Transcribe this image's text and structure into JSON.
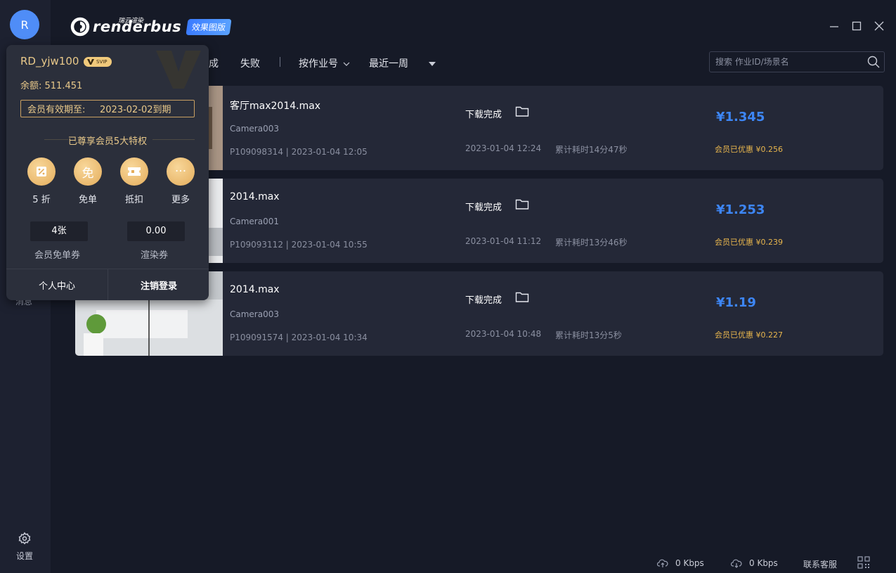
{
  "app": {
    "logo_small": "瑞云渲染",
    "logo_name": "renderbus",
    "logo_badge": "效果图版"
  },
  "rail": {
    "avatar_letter": "R",
    "messages_label": "消息",
    "settings_label": "设置"
  },
  "filter": {
    "tab_done_partial": "成",
    "tab_failed": "失败",
    "sort_by_job": "按作业号",
    "range": "最近一周",
    "search_placeholder": "搜索 作业ID/场景名"
  },
  "jobs": [
    {
      "title": "客厅max2014.max",
      "camera": "Camera003",
      "meta": "P109098314 | 2023-01-04 12:05",
      "status": "下载完成",
      "end_time": "2023-01-04 12:24",
      "duration": "累计耗时14分47秒",
      "price": "¥1.345",
      "discount": "会员已优惠 ¥0.256"
    },
    {
      "title": "2014.max",
      "camera": "Camera001",
      "meta": "P109093112 | 2023-01-04 10:55",
      "status": "下载完成",
      "end_time": "2023-01-04 11:12",
      "duration": "累计耗时13分46秒",
      "price": "¥1.253",
      "discount": "会员已优惠 ¥0.239"
    },
    {
      "title": "2014.max",
      "camera": "Camera003",
      "meta": "P109091574 | 2023-01-04 10:34",
      "status": "下载完成",
      "end_time": "2023-01-04 10:48",
      "duration": "累计耗时13分5秒",
      "price": "¥1.19",
      "discount": "会员已优惠 ¥0.227"
    }
  ],
  "popover": {
    "username": "RD_yjw100",
    "svip": "SVIP",
    "balance": "余额: 511.451",
    "valid_label": "会员有效期至:",
    "valid_value": "2023-02-02到期",
    "privileges_title": "已尊享会员5大特权",
    "perks": [
      {
        "label": "5 折",
        "icon": "percent-icon"
      },
      {
        "label": "免单",
        "icon": "free-icon",
        "glyph": "免"
      },
      {
        "label": "抵扣",
        "icon": "coupon-icon"
      },
      {
        "label": "更多",
        "icon": "more-icon",
        "glyph": "···"
      }
    ],
    "free_coupon_value": "4张",
    "free_coupon_label": "会员免单券",
    "render_coupon_value": "0.00",
    "render_coupon_label": "渲染券",
    "personal_center": "个人中心",
    "logout": "注销登录"
  },
  "statusbar": {
    "upload": "0 Kbps",
    "download": "0 Kbps",
    "support": "联系客服"
  }
}
